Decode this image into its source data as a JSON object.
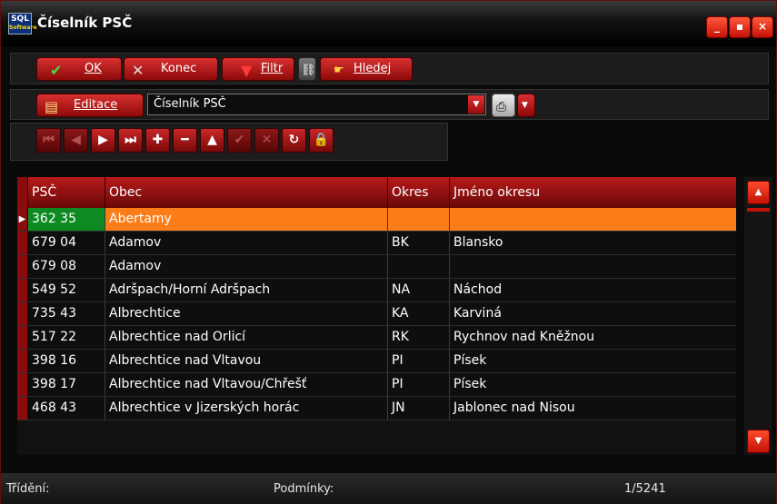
{
  "window": {
    "title": "Číselník PSČ",
    "logo": "SQL",
    "logo_sub": "Software"
  },
  "toolbar": {
    "ok_label": "OK",
    "konec_label": "Konec",
    "filtr_label": "Filtr",
    "hledej_label": "Hledej",
    "editace_label": "Editace"
  },
  "combo": {
    "value": "Číselník PSČ"
  },
  "grid": {
    "columns": [
      "PSČ",
      "Obec",
      "Okres",
      "Jméno okresu"
    ],
    "rows": [
      {
        "psc": "362 35",
        "obec": "Abertamy",
        "okres": "",
        "jmeno": ""
      },
      {
        "psc": "679 04",
        "obec": "Adamov",
        "okres": "BK",
        "jmeno": "Blansko"
      },
      {
        "psc": "679 08",
        "obec": "Adamov",
        "okres": "",
        "jmeno": ""
      },
      {
        "psc": "549 52",
        "obec": "Adršpach/Horní Adršpach",
        "okres": "NA",
        "jmeno": "Náchod"
      },
      {
        "psc": "735 43",
        "obec": "Albrechtice",
        "okres": "KA",
        "jmeno": "Karviná"
      },
      {
        "psc": "517 22",
        "obec": "Albrechtice nad Orlicí",
        "okres": "RK",
        "jmeno": "Rychnov nad Kněžnou"
      },
      {
        "psc": "398 16",
        "obec": "Albrechtice nad Vltavou",
        "okres": "PI",
        "jmeno": "Písek"
      },
      {
        "psc": "398 17",
        "obec": "Albrechtice nad Vltavou/Chřešť",
        "okres": "PI",
        "jmeno": "Písek"
      },
      {
        "psc": "468 43",
        "obec": "Albrechtice v Jizerských horác",
        "okres": "JN",
        "jmeno": "Jablonec nad Nisou"
      }
    ],
    "selected_index": 0
  },
  "status": {
    "trideni": "Třídění:",
    "podminky": "Podmínky:",
    "position": "1/5241"
  },
  "colors": {
    "accent": "#c41208",
    "selected_row": "#fb7d1a",
    "selected_psc": "#0e8a22"
  }
}
